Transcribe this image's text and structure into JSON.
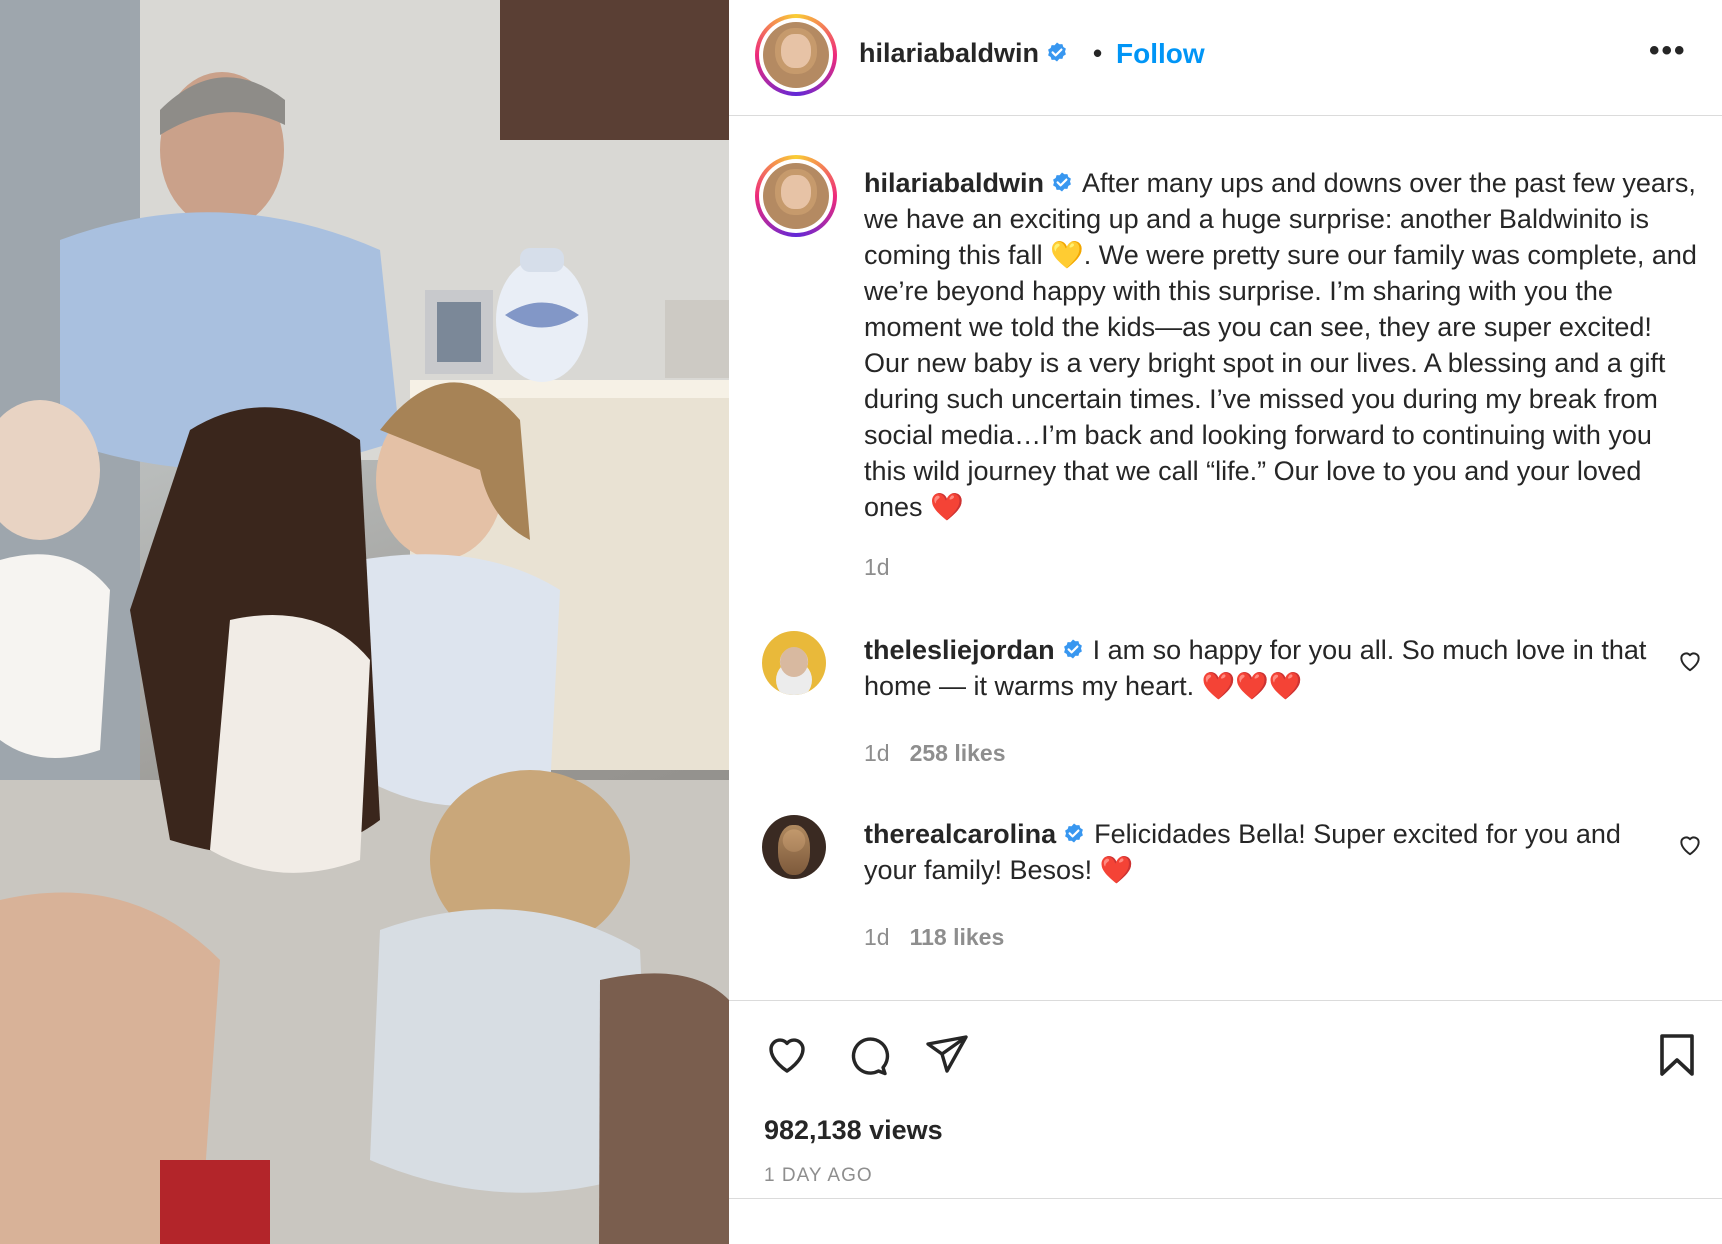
{
  "post": {
    "username": "hilariabaldwin",
    "separator": "•",
    "follow_label": "Follow",
    "more_label": "•••"
  },
  "caption": {
    "username": "hilariabaldwin",
    "text": "After many ups and downs over the past few years, we have an exciting up and a huge surprise: another Baldwinito is coming this fall 💛. We were pretty sure our family was complete, and we’re beyond happy with this surprise. I’m sharing with you the moment we told the kids—as you can see, they are super excited! Our new baby is a very bright spot in our lives. A blessing and a gift during such uncertain times. I’ve missed you during my break from social media…I’m back and looking forward to continuing with you this wild journey that we call “life.” Our love to you and your loved ones ❤️",
    "time": "1d"
  },
  "comments": [
    {
      "username": "thelesliejordan",
      "text": "I am so happy for you all. So much love in that home — it warms my heart. ❤️❤️❤️",
      "time": "1d",
      "likes": "258 likes"
    },
    {
      "username": "therealcarolina",
      "text": "Felicidades Bella! Super excited for you and your family! Besos! ❤️",
      "time": "1d",
      "likes": "118 likes"
    }
  ],
  "stats": {
    "views": "982,138 views",
    "date": "1 DAY AGO"
  },
  "icons": {
    "verified": "verified-badge-icon",
    "like": "heart-outline-icon",
    "comment": "speech-bubble-icon",
    "share": "paper-plane-icon",
    "save": "bookmark-icon",
    "more": "ellipsis-icon"
  },
  "colors": {
    "accent": "#0095f6",
    "verified": "#3897f0",
    "text": "#262626",
    "muted": "#8e8e8e",
    "border": "#dbdbdb"
  }
}
